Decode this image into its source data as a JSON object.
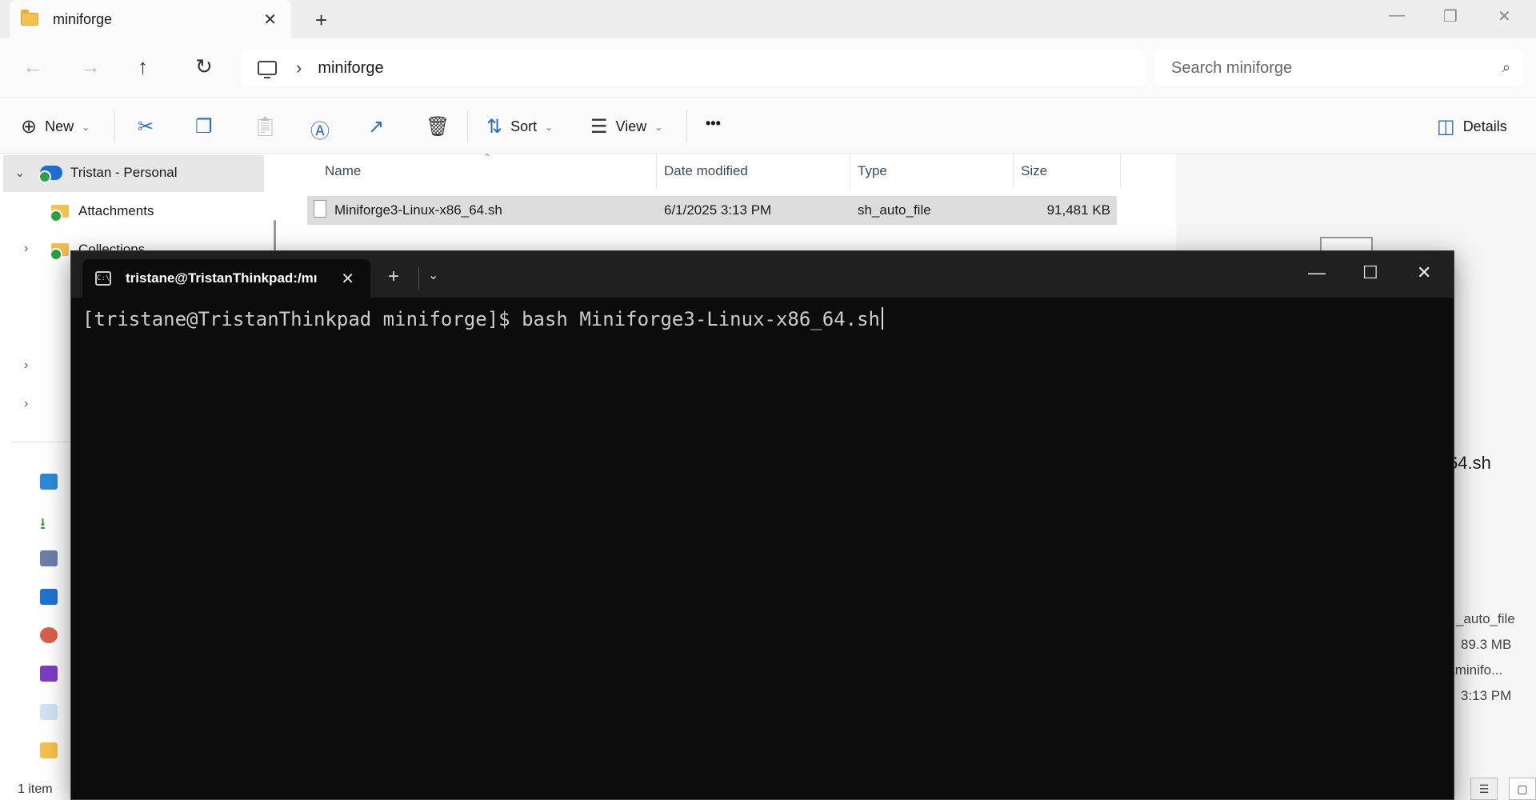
{
  "explorer": {
    "tab_title": "miniforge",
    "address": {
      "path": "miniforge"
    },
    "search": {
      "placeholder": "Search miniforge"
    },
    "toolbar": {
      "new_label": "New",
      "sort_label": "Sort",
      "view_label": "View",
      "more_label": "•••",
      "details_label": "Details"
    },
    "nav_pane": {
      "selected": "Tristan - Personal",
      "items": [
        "Attachments",
        "Collections"
      ]
    },
    "columns": [
      "Name",
      "Date modified",
      "Type",
      "Size"
    ],
    "files": [
      {
        "name": "Miniforge3-Linux-x86_64.sh",
        "date": "6/1/2025 3:13 PM",
        "type": "sh_auto_file",
        "size": "91,481 KB"
      }
    ],
    "details_pane": {
      "name_fragment": "64.sh",
      "type_fragment": "_auto_file",
      "size": "89.3 MB",
      "path_fragment": "\\minifo...",
      "time_fragment": "3:13 PM"
    },
    "status": "1 item"
  },
  "terminal": {
    "tab_title": "tristane@TristanThinkpad:/mı",
    "prompt": "[tristane@TristanThinkpad miniforge]$ ",
    "command": "bash Miniforge3-Linux-x86_64.sh"
  }
}
